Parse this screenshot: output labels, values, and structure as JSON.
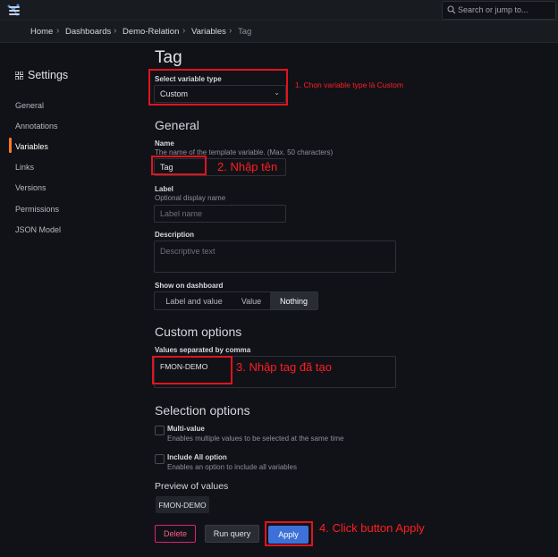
{
  "search": {
    "placeholder": "Search or jump to..."
  },
  "breadcrumb": [
    "Home",
    "Dashboards",
    "Demo-Relation",
    "Variables",
    "Tag"
  ],
  "sidebar": {
    "title": "Settings",
    "items": [
      {
        "label": "General"
      },
      {
        "label": "Annotations"
      },
      {
        "label": "Variables"
      },
      {
        "label": "Links"
      },
      {
        "label": "Versions"
      },
      {
        "label": "Permissions"
      },
      {
        "label": "JSON Model"
      }
    ],
    "active": "Variables"
  },
  "page": {
    "title": "Tag",
    "variable_type": {
      "label": "Select variable type",
      "value": "Custom"
    },
    "general": {
      "heading": "General",
      "name": {
        "label": "Name",
        "description": "The name of the template variable. (Max. 50 characters)",
        "value": "Tag"
      },
      "label_field": {
        "label": "Label",
        "description": "Optional display name",
        "placeholder": "Label name"
      },
      "description_field": {
        "label": "Description",
        "placeholder": "Descriptive text"
      },
      "show_on_dashboard": {
        "label": "Show on dashboard",
        "options": [
          "Label and value",
          "Value",
          "Nothing"
        ],
        "selected": "Nothing"
      }
    },
    "custom_options": {
      "heading": "Custom options",
      "label": "Values separated by comma",
      "value": "FMON-DEMO"
    },
    "selection_options": {
      "heading": "Selection options",
      "multi_value": {
        "label": "Multi-value",
        "description": "Enables multiple values to be selected at the same time",
        "checked": false
      },
      "include_all": {
        "label": "Include All option",
        "description": "Enables an option to include all variables",
        "checked": false
      }
    },
    "preview": {
      "heading": "Preview of values",
      "values": [
        "FMON-DEMO"
      ]
    },
    "buttons": {
      "delete": "Delete",
      "run_query": "Run query",
      "apply": "Apply"
    }
  },
  "annotations": {
    "step1": "1. Chọn variable type là Custom",
    "step2": "2. Nhập tên",
    "step3": "3. Nhập tag đã tạo",
    "step4": "4. Click button Apply"
  },
  "colors": {
    "background": "#111217",
    "active_accent": "#f57926",
    "apply_button": "#3d71d9",
    "delete_button": "#e0226e",
    "annotation_red": "#e0141e"
  }
}
